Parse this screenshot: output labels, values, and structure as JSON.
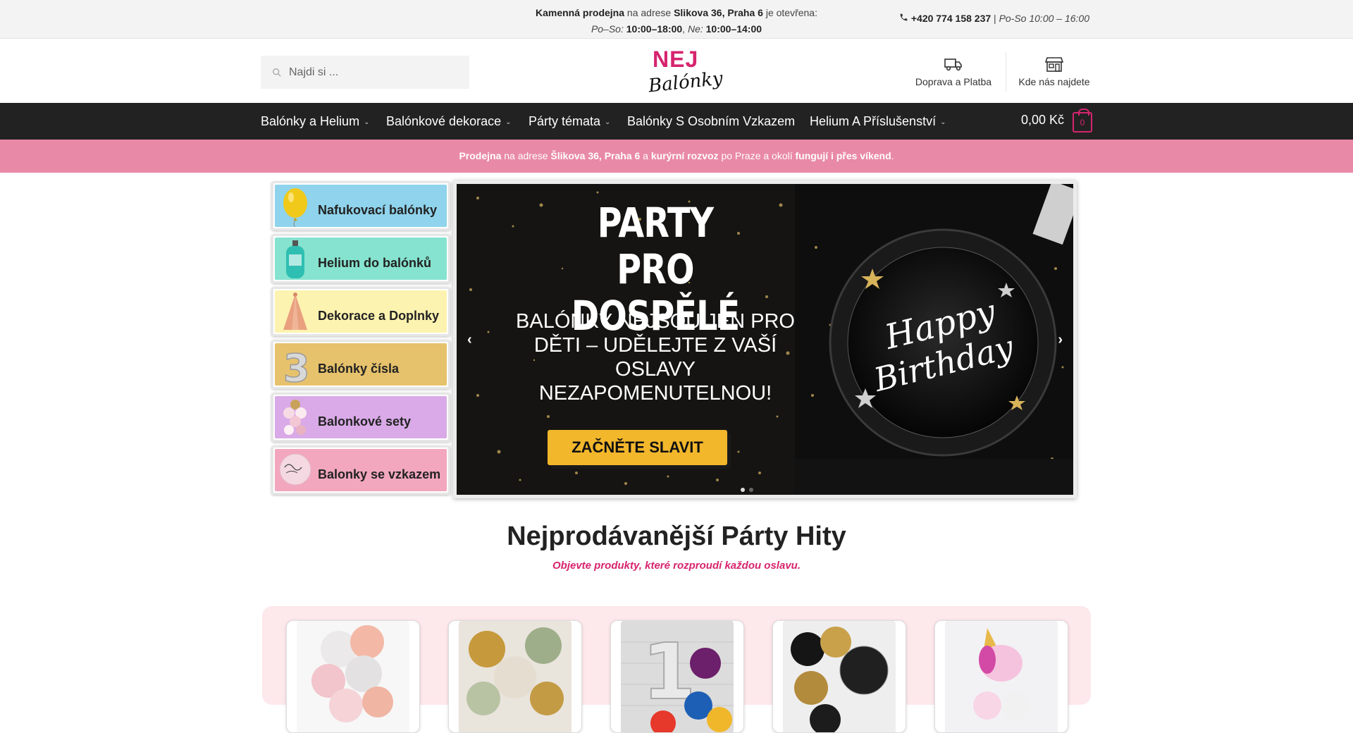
{
  "topbar": {
    "store_prefix": "Kamenná prodejna",
    "store_mid": " na adrese ",
    "store_address": "Slikova 36, Praha 6",
    "store_suffix": " je otevřena:",
    "hours_weekday_label": "Po–So:",
    "hours_weekday": "10:00–18:00",
    "hours_sep": ",",
    "hours_sunday_label": "Ne:",
    "hours_sunday": "10:00–14:00",
    "phone": "+420 774 158 237",
    "phone_sep": " | ",
    "phone_hours": "Po-So 10:00 – 16:00"
  },
  "header": {
    "search_placeholder": "Najdi si ...",
    "logo_top": "NEJ",
    "logo_bottom": "Balónky",
    "delivery_label": "Doprava a Platba",
    "stores_label": "Kde nás najdete"
  },
  "nav": {
    "items": [
      {
        "label": "Balónky a Helium",
        "dropdown": "⌄"
      },
      {
        "label": "Balónkové dekorace",
        "dropdown": "⌄"
      },
      {
        "label": "Párty témata",
        "dropdown": "⌄"
      },
      {
        "label": "Balónky S Osobním Vzkazem",
        "dropdown": ""
      },
      {
        "label": "Helium A Příslušenství",
        "dropdown": "⌄"
      }
    ],
    "cart_total": "0,00 Kč",
    "cart_count": "0"
  },
  "promo": {
    "p1": "Prodejna",
    "p2": " na adrese ",
    "p3": "Šlikova 36, Praha 6",
    "p4": " a ",
    "p5": "kurýrní rozvoz",
    "p6": " po Praze a okolí ",
    "p7": "fungují i přes víkend",
    "p8": "."
  },
  "categories": [
    {
      "label": "Nafukovací balónky",
      "color": "#8fd3ec"
    },
    {
      "label": "Helium do balónků",
      "color": "#86e3cf"
    },
    {
      "label": "Dekorace a Doplnky",
      "color": "#fdf3b0"
    },
    {
      "label": "Balónky čísla",
      "color": "#e7c26c"
    },
    {
      "label": "Balonkové sety",
      "color": "#d9aae7"
    },
    {
      "label": "Balonky se vzkazem",
      "color": "#f2a7bf"
    }
  ],
  "slider": {
    "title_line1": "PARTY",
    "title_line2": "PRO DOSPĚLÉ",
    "subtitle": "BALÓNKY NEJSOU JEN PRO DĚTI – UDĚLEJTE Z VAŠÍ OSLAVY NEZAPOMENUTELNOU!",
    "cta": "ZAČNĚTE SLAVIT",
    "plate_line1": "Happy",
    "plate_line2": "Birthday",
    "prev": "‹",
    "next": "›"
  },
  "section": {
    "title": "Nejprodávanější Párty Hity",
    "subtitle": "Objevte produkty, které rozproudí každou oslavu."
  },
  "colors": {
    "accent": "#d6246e",
    "promo_bg": "#e989a8",
    "nav_bg": "#222222",
    "cta": "#f3b72c"
  }
}
